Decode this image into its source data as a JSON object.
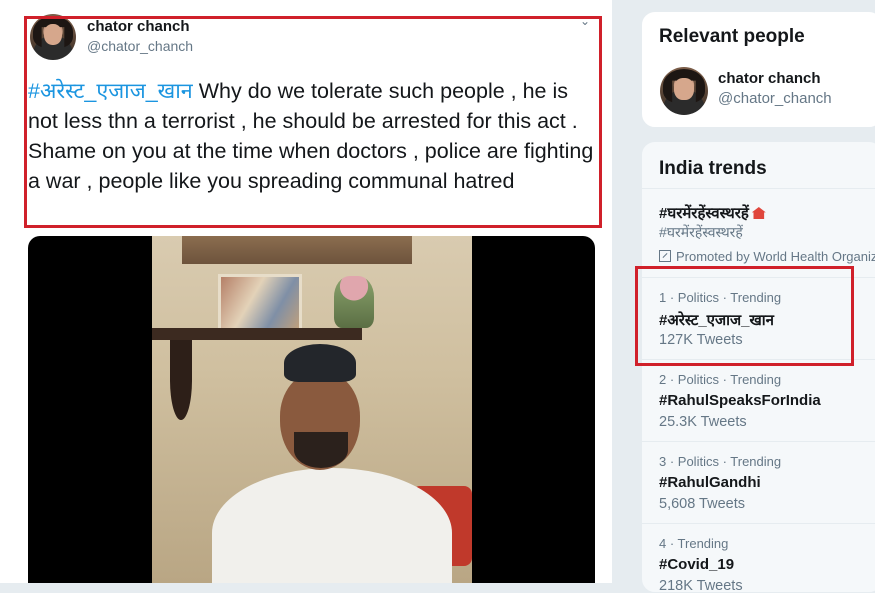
{
  "tweet": {
    "name": "chator chanch",
    "handle": "@chator_chanch",
    "hashtag": "#अरेस्ट_एजाज_खान",
    "body": " Why do we tolerate such people , he is not less thn a terrorist , he should be arrested for this act . Shame on you at the time when doctors , police are fighting a war , people like you spreading communal hatred",
    "more_icon": "chevron-down-icon"
  },
  "sidebar": {
    "relevant_people": {
      "title": "Relevant people",
      "person": {
        "name": "chator chanch",
        "handle": "@chator_chanch"
      }
    },
    "trends": {
      "title": "India trends",
      "promoted": {
        "name": "#घरमेंरहेंस्वस्थरहें",
        "subtitle": "#घरमेंरहेंस्वस्थरहें",
        "promoted_by": "Promoted by World Health Organiz"
      },
      "items": [
        {
          "meta": "1 · Politics · Trending",
          "name": "#अरेस्ट_एजाज_खान",
          "count": "127K Tweets"
        },
        {
          "meta": "2 · Politics · Trending",
          "name": "#RahulSpeaksForIndia",
          "count": "25.3K Tweets"
        },
        {
          "meta": "3 · Politics · Trending",
          "name": "#RahulGandhi",
          "count": "5,608 Tweets"
        },
        {
          "meta": "4 · Trending",
          "name": "#Covid_19",
          "count": "218K Tweets"
        }
      ]
    }
  },
  "colors": {
    "highlight_box": "#d0202a",
    "hashtag": "#1b95e0",
    "secondary_text": "#657786"
  }
}
